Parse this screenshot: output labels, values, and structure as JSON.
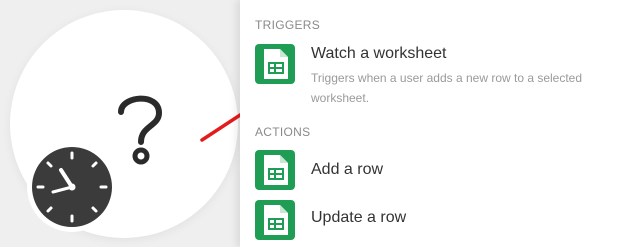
{
  "colors": {
    "accent_green": "#1f9d55",
    "arrow_red": "#e31b1b",
    "clock_dark": "#3b3b3b"
  },
  "module": {
    "icon": "question-mark-icon",
    "badge_icon": "clock-icon"
  },
  "triggers": {
    "title": "TRIGGERS",
    "items": [
      {
        "label": "Watch a worksheet",
        "description": "Triggers when a user adds a new row to a selected worksheet.",
        "icon": "google-sheets-icon"
      }
    ]
  },
  "actions": {
    "title": "ACTIONS",
    "items": [
      {
        "label": "Add a row",
        "icon": "google-sheets-icon"
      },
      {
        "label": "Update a row",
        "icon": "google-sheets-icon"
      }
    ]
  }
}
